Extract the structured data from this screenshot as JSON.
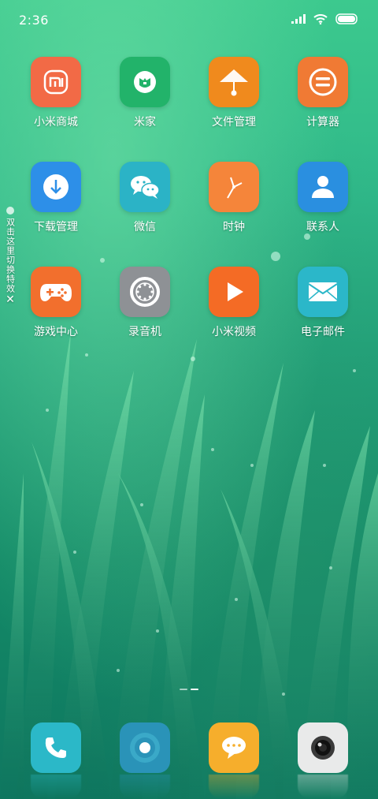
{
  "status_bar": {
    "time": "2:36"
  },
  "side_hint": {
    "text": "双击这里切换特效",
    "close": "✕"
  },
  "apps": [
    {
      "label": "小米商城",
      "icon": "mi-store-icon",
      "color": "#f26a46"
    },
    {
      "label": "米家",
      "icon": "mijia-icon",
      "color": "#22b36a"
    },
    {
      "label": "文件管理",
      "icon": "file-manager-icon",
      "color": "#f08a1d"
    },
    {
      "label": "计算器",
      "icon": "calculator-icon",
      "color": "#f07a34"
    },
    {
      "label": "下载管理",
      "icon": "download-icon",
      "color": "#2d8fe8"
    },
    {
      "label": "微信",
      "icon": "wechat-icon",
      "color": "#2bb3c6"
    },
    {
      "label": "时钟",
      "icon": "clock-icon",
      "color": "#f5853a"
    },
    {
      "label": "联系人",
      "icon": "contacts-icon",
      "color": "#2a8fe0"
    },
    {
      "label": "游戏中心",
      "icon": "game-center-icon",
      "color": "#f26f2d"
    },
    {
      "label": "录音机",
      "icon": "recorder-icon",
      "color": "#8e9195"
    },
    {
      "label": "小米视频",
      "icon": "video-icon",
      "color": "#f46b25"
    },
    {
      "label": "电子邮件",
      "icon": "email-icon",
      "color": "#2bb7c9"
    }
  ],
  "dock": [
    {
      "icon": "phone-icon",
      "color": "#2bb8c8"
    },
    {
      "icon": "browser-icon",
      "color": "#2a93b8"
    },
    {
      "icon": "messages-icon",
      "color": "#f6ae2c"
    },
    {
      "icon": "camera-icon",
      "color": "#e9eaea"
    }
  ],
  "pager": {
    "pages": 2,
    "active": 1
  }
}
